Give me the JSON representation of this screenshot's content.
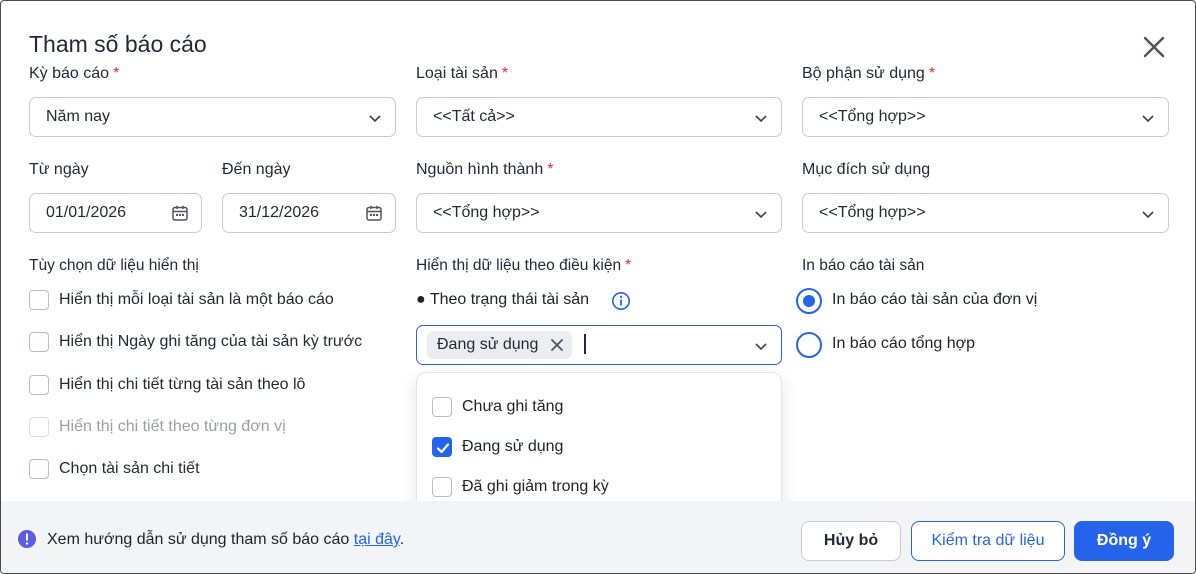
{
  "dialog": {
    "title": "Tham số báo cáo"
  },
  "period": {
    "label": "Kỳ báo cáo",
    "value": "Năm nay"
  },
  "asset_type": {
    "label": "Loại tài sản",
    "value": "<<Tất cả>>"
  },
  "department": {
    "label": "Bộ phận sử dụng",
    "value": "<<Tổng hợp>>"
  },
  "from_date": {
    "label": "Từ ngày",
    "value": "01/01/2026"
  },
  "to_date": {
    "label": "Đến ngày",
    "value": "31/12/2026"
  },
  "source": {
    "label": "Nguồn hình thành",
    "value": "<<Tổng hợp>>"
  },
  "purpose": {
    "label": "Mục đích sử dụng",
    "value": "<<Tổng hợp>>"
  },
  "display_options": {
    "label": "Tùy chọn dữ liệu hiển thị",
    "items": [
      {
        "label": "Hiển thị mỗi loại tài sản là một báo cáo",
        "checked": false,
        "disabled": false
      },
      {
        "label": "Hiển thị Ngày ghi tăng của tài sản kỳ trước",
        "checked": false,
        "disabled": false
      },
      {
        "label": "Hiển thị chi tiết từng tài sản theo lô",
        "checked": false,
        "disabled": false
      },
      {
        "label": "Hiển thị chi tiết theo từng đơn vị",
        "checked": false,
        "disabled": true
      },
      {
        "label": "Chọn tài sản chi tiết",
        "checked": false,
        "disabled": false
      }
    ]
  },
  "condition": {
    "label": "Hiển thị dữ liệu theo điều kiện",
    "bullet": "● Theo trạng thái tài sản",
    "chip": "Đang sử dụng",
    "options": [
      {
        "label": "Chưa ghi tăng",
        "checked": false
      },
      {
        "label": "Đang sử dụng",
        "checked": true
      },
      {
        "label": "Đã ghi giảm trong kỳ",
        "checked": false
      }
    ]
  },
  "print": {
    "label": "In báo cáo tài sản",
    "options": [
      {
        "label": "In báo cáo tài sản của đơn vị",
        "selected": true
      },
      {
        "label": "In báo cáo tổng hợp",
        "selected": false
      }
    ]
  },
  "footer": {
    "help_text": "Xem hướng dẫn sử dụng tham số báo cáo ",
    "help_link": "tại đây",
    "help_suffix": ".",
    "cancel": "Hủy bỏ",
    "check": "Kiểm tra dữ liệu",
    "ok": "Đồng ý"
  },
  "colors": {
    "accent": "#2563eb",
    "required": "#e5243b",
    "footer_bg": "#f3f4f6"
  }
}
